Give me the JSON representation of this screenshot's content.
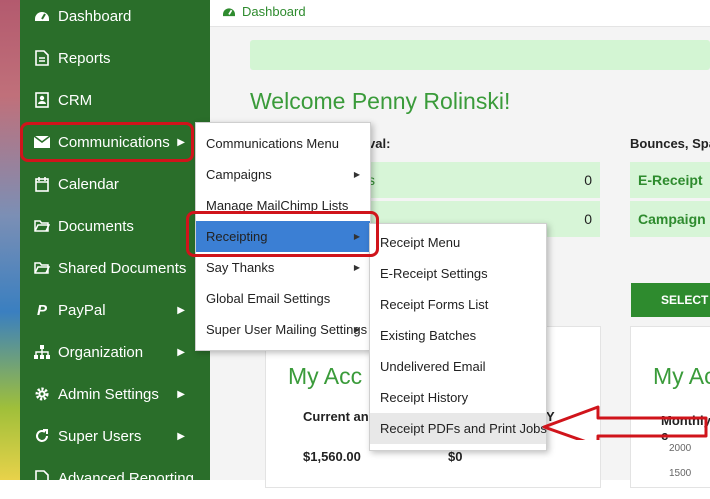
{
  "sidebar": {
    "items": [
      {
        "label": "Dashboard",
        "icon": "dashboard-icon"
      },
      {
        "label": "Reports",
        "icon": "file-icon"
      },
      {
        "label": "CRM",
        "icon": "contact-card-icon"
      },
      {
        "label": "Communications",
        "icon": "envelope-icon"
      },
      {
        "label": "Calendar",
        "icon": "calendar-icon"
      },
      {
        "label": "Documents",
        "icon": "folder-open-icon"
      },
      {
        "label": "Shared Documents",
        "icon": "folder-open-icon"
      },
      {
        "label": "PayPal",
        "icon": "paypal-icon"
      },
      {
        "label": "Organization",
        "icon": "sitemap-icon"
      },
      {
        "label": "Admin Settings",
        "icon": "gear-icon"
      },
      {
        "label": "Super Users",
        "icon": "refresh-icon"
      },
      {
        "label": "Advanced Reporting",
        "icon": "file-icon"
      }
    ]
  },
  "breadcrumb": {
    "label": "Dashboard"
  },
  "welcome": "Welcome Penny Rolinski!",
  "section_labels": {
    "approval": "val:",
    "bounces": "Bounces, Spa"
  },
  "summary_boxes": [
    {
      "text": "s",
      "value": "0"
    },
    {
      "text": "",
      "value": "0"
    },
    {
      "text": "E-Receipt",
      "value": ""
    },
    {
      "text": "Campaign a",
      "value": ""
    }
  ],
  "select_button": "SELECT C",
  "cards": {
    "left": {
      "title": "My Acc",
      "sub_label": "Current an",
      "amount1": "$1,560.00",
      "amount2": "$0",
      "trailing": "Y"
    },
    "right": {
      "title": "My Ac",
      "sub_label": "Monthly c",
      "ticks": [
        "2000",
        "1500"
      ]
    }
  },
  "communications_menu": [
    {
      "label": "Communications Menu",
      "has_sub": false
    },
    {
      "label": "Campaigns",
      "has_sub": true
    },
    {
      "label": "Manage MailChimp Lists",
      "has_sub": false
    },
    {
      "label": "Receipting",
      "has_sub": true
    },
    {
      "label": "Say Thanks",
      "has_sub": true
    },
    {
      "label": "Global Email Settings",
      "has_sub": false
    },
    {
      "label": "Super User Mailing Settings",
      "has_sub": true
    }
  ],
  "receipting_menu": [
    {
      "label": "Receipt Menu"
    },
    {
      "label": "E-Receipt Settings"
    },
    {
      "label": "Receipt Forms List"
    },
    {
      "label": "Existing Batches"
    },
    {
      "label": "Undelivered Email"
    },
    {
      "label": "Receipt History"
    },
    {
      "label": "Receipt PDFs and Print Jobs"
    }
  ],
  "colors": {
    "sidebar": "#2a6e2a",
    "accent": "#3a9b3a",
    "highlight": "#d0141b",
    "active_item": "#3b7fd4"
  }
}
